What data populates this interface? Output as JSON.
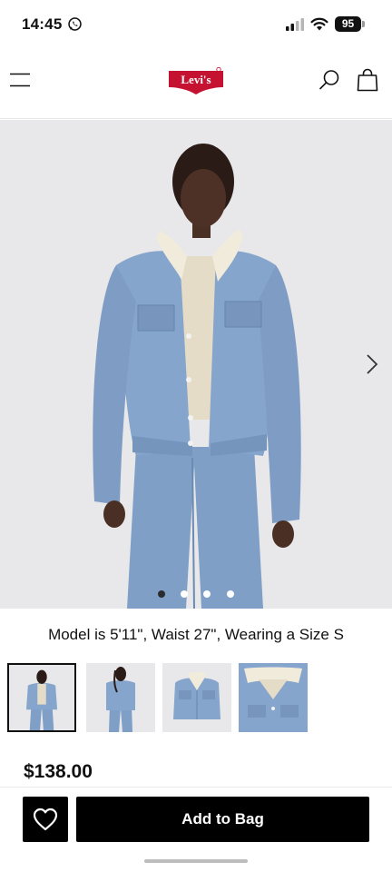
{
  "status": {
    "time": "14:45",
    "battery": "95"
  },
  "header": {
    "logo_text": "Levi's",
    "brand_color": "#c41230"
  },
  "product": {
    "model_info": "Model is 5'11\", Waist 27\", Wearing a Size S",
    "price": "$138.00",
    "carousel": {
      "image_count": 4,
      "active_index": 0
    },
    "thumbnails": [
      "front-view",
      "back-view",
      "jacket-front",
      "collar-detail"
    ]
  },
  "actions": {
    "add_to_bag": "Add to Bag"
  },
  "icons": {
    "menu": "menu-icon",
    "search": "search-icon",
    "bag": "shopping-bag-icon",
    "heart": "heart-icon",
    "next": "chevron-right-icon"
  }
}
